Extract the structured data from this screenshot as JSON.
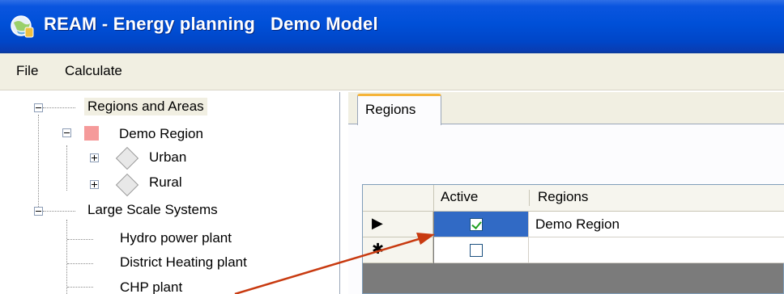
{
  "window": {
    "title": "REAM - Energy planning   Demo Model",
    "icon": "app-globe-icon",
    "colors": {
      "title_bar": "#0050d8",
      "menu_bar": "#f1efe2",
      "selection": "#316ac5",
      "tab_accent": "#f5b43a",
      "annotation_arrow": "#c83a10"
    }
  },
  "menu": {
    "file": "File",
    "calculate": "Calculate"
  },
  "tree": {
    "regions_and_areas": "Regions and Areas",
    "demo_region": "Demo Region",
    "urban": "Urban",
    "rural": "Rural",
    "large_scale_systems": "Large Scale Systems",
    "hydro": "Hydro power plant",
    "district_heating": "District Heating plant",
    "chp": "CHP plant"
  },
  "tabs": {
    "regions": "Regions"
  },
  "grid": {
    "columns": [
      "Active",
      "Regions"
    ],
    "rows": [
      {
        "indicator": "▶",
        "active": true,
        "region": "Demo Region"
      },
      {
        "indicator": "✱",
        "active": false,
        "region": ""
      }
    ]
  }
}
